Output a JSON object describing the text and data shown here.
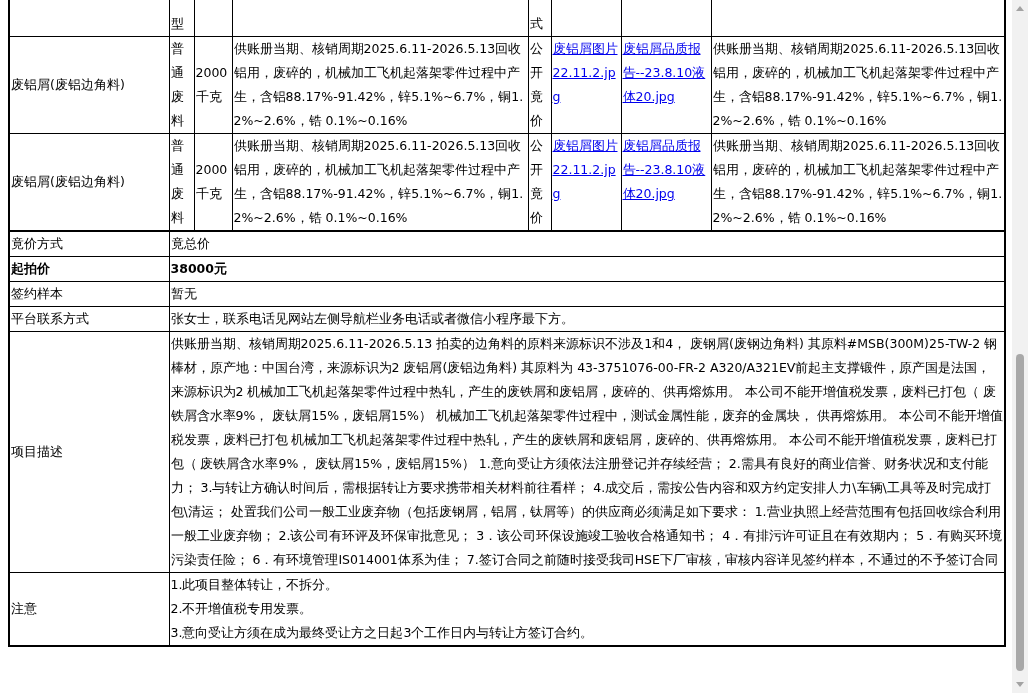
{
  "items_table": {
    "header_partial": {
      "type": "型",
      "method": "式"
    },
    "rows": [
      {
        "name": "废铝屑(废铝边角料)",
        "type": "普通废料",
        "quantity": "2000千克",
        "description": "供账册当期、核销周期2025.6.11-2026.5.13回收铝用，废碎的，机械加工飞机起落架零件过程中产生，含铝88.17%-91.42%，锌5.1%~6.7%，铜1.2%~2.6%，锆 0.1%~0.16%",
        "method": "公开竟价",
        "image_link": "废铝屑图片 22.11.2.jpg",
        "report_link": "废铝屑品质报告--23.8.10液体20.jpg",
        "remark": "供账册当期、核销周期2025.6.11-2026.5.13回收铝用，废碎的，机械加工飞机起落架零件过程中产生，含铝88.17%-91.42%，锌5.1%~6.7%，铜1.2%~2.6%，锆 0.1%~0.16%"
      },
      {
        "name": "废铝屑(废铝边角料)",
        "type": "普通废料",
        "quantity": "2000千克",
        "description": "供账册当期、核销周期2025.6.11-2026.5.13回收铝用，废碎的，机械加工飞机起落架零件过程中产生，含铝88.17%-91.42%，锌5.1%~6.7%，铜1.2%~2.6%，锆 0.1%~0.16%",
        "method": "公开竟价",
        "image_link": "废铝屑图片 22.11.2.jpg",
        "report_link": "废铝屑品质报告--23.8.10液体20.jpg",
        "remark": "供账册当期、核销周期2025.6.11-2026.5.13回收铝用，废碎的，机械加工飞机起落架零件过程中产生，含铝88.17%-91.42%，锌5.1%~6.7%，铜1.2%~2.6%，锆 0.1%~0.16%"
      }
    ]
  },
  "details": [
    {
      "label": "竟价方式",
      "value": "竟总价",
      "bold": false
    },
    {
      "label": "起拍价",
      "value": "38000元",
      "bold": true
    },
    {
      "label": "签约样本",
      "value": "暂无",
      "bold": false
    },
    {
      "label": "平台联系方式",
      "value": "张女士，联系电话见网站左侧导航栏业务电话或者微信小程序最下方。",
      "bold": false
    }
  ],
  "project_description": {
    "label": "项目描述",
    "text": "供账册当期、核销周期2025.6.11-2026.5.13 拍卖的边角料的原料来源标识不涉及1和4， 废钢屑(废钢边角料) 其原料#MSB(300M)25-TW-2 钢棒材，原产地：中国台湾，来源标识为2 废铝屑(废铝边角料) 其原料为 43-3751076-00-FR-2 A320/A321EV前起主支撑锻件，原产国是法国，来源标识为2 机械加工飞机起落架零件过程中热轧，产生的废铁屑和废铝屑，废碎的、供再熔炼用。 本公司不能开增值税发票，废料已打包（ 废铁屑含水率9%， 废钛屑15%，废铝屑15%） 机械加工飞机起落架零件过程中，测试金属性能，废弃的金属块， 供再熔炼用。 本公司不能开增值税发票，废料已打包 机械加工飞机起落架零件过程中热轧，产生的废铁屑和废铝屑，废碎的、供再熔炼用。 本公司不能开增值税发票，废料已打包（ 废铁屑含水率9%， 废钛屑15%，废铝屑15%） 1.意向受让方须依法注册登记并存续经营； 2.需具有良好的商业信誉、财务状况和支付能力； 3.与转让方确认时间后，需根据转让方要求携带相关材料前往看样； 4.成交后，需按公告内容和双方约定安排人力\\车辆\\工具等及时完成打包\\清运； 处置我们公司一般工业废弃物（包括废钢屑，铝屑，钛屑等）的供应商必须满足如下要求： 1.营业执照上经营范围有包括回收综合利用一般工业废弃物； 2.该公司有环评及环保审批意见； 3．该公司环保设施竣工验收合格通知书； 4．有排污许可证且在有效期内； 5．有购买环境污染责任险； 6．有环境管理IS014001体系为佳； 7.签订合同之前随时接受我司HSE下厂审核，审核内容详见签约样本，不通过的不予签订合同"
  },
  "notes": {
    "label": "注意",
    "lines": [
      "1.此项目整体转让，不拆分。",
      "2.不开增值税专用发票。",
      "3.意向受让方须在成为最终受让方之日起3个工作日内与转让方签订合约。"
    ]
  }
}
